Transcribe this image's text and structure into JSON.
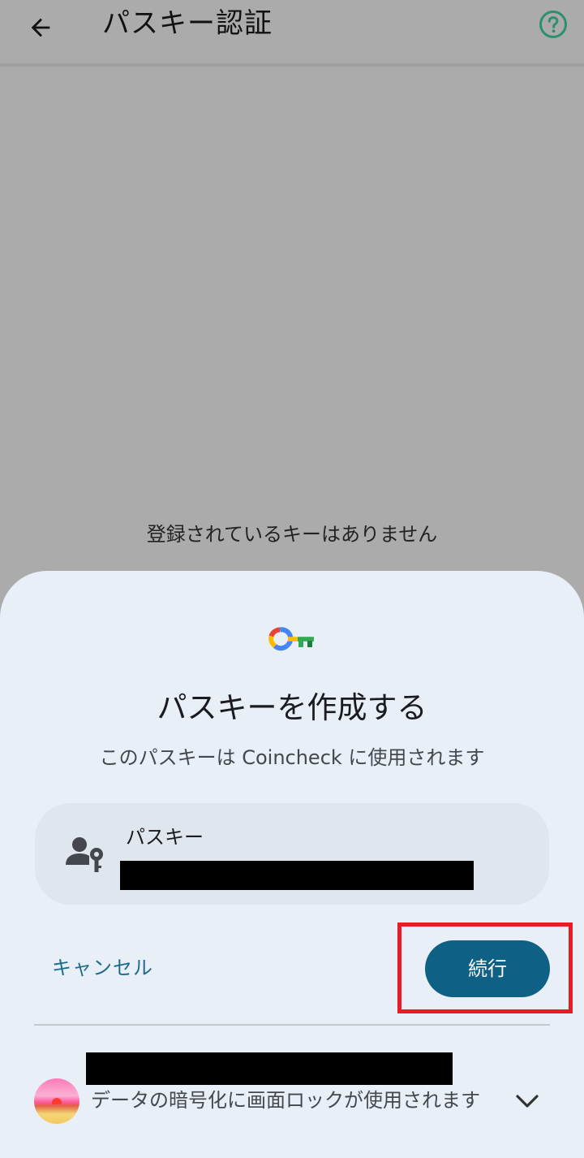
{
  "appbar": {
    "title": "パスキー認証",
    "back_icon": "arrow-left-icon",
    "help_icon": "help-circle-icon"
  },
  "main": {
    "empty_message": "登録されているキーはありません"
  },
  "sheet": {
    "logo_icon": "passkey-logo-icon",
    "title": "パスキーを作成する",
    "subtitle": "このパスキーは Coincheck に使用されます",
    "account": {
      "icon": "person-key-icon",
      "label": "パスキー"
    },
    "cancel_label": "キャンセル",
    "continue_label": "続行",
    "screen_lock_text": "データの暗号化に画面ロックが使用されます",
    "expand_icon": "chevron-down-icon"
  },
  "colors": {
    "background_dim": "#ababab",
    "sheet_bg": "#e8eff7",
    "primary": "#0e6184",
    "highlight": "#e81c24",
    "help_accent": "#2e8f6e"
  }
}
